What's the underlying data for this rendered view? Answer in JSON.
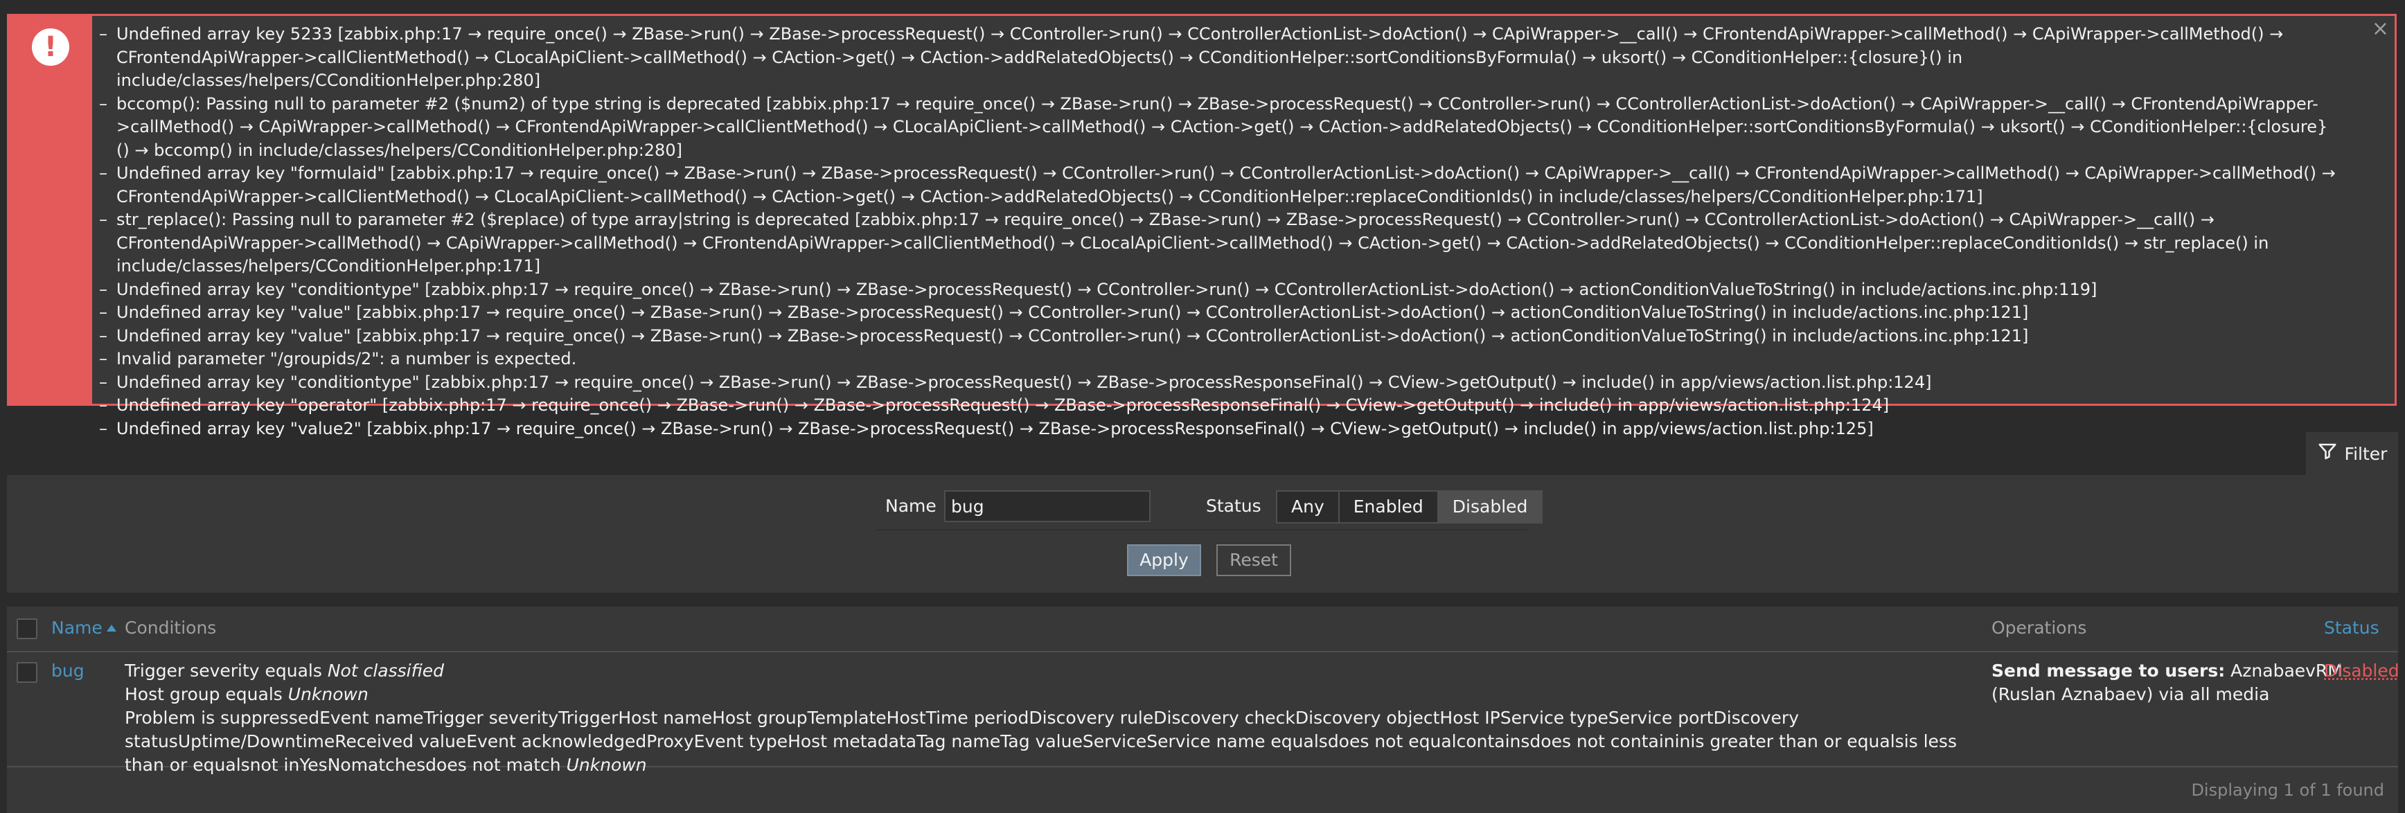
{
  "errors": {
    "close_label": "×",
    "icon_label": "!",
    "messages": [
      "Undefined array key 5233 [zabbix.php:17 → require_once() → ZBase->run() → ZBase->processRequest() → CController->run() → CControllerActionList->doAction() → CApiWrapper->__call() → CFrontendApiWrapper->callMethod() → CApiWrapper->callMethod() → CFrontendApiWrapper->callClientMethod() → CLocalApiClient->callMethod() → CAction->get() → CAction->addRelatedObjects() → CConditionHelper::sortConditionsByFormula() → uksort() → CConditionHelper::{closure}() in include/classes/helpers/CConditionHelper.php:280]",
      "bccomp(): Passing null to parameter #2 ($num2) of type string is deprecated [zabbix.php:17 → require_once() → ZBase->run() → ZBase->processRequest() → CController->run() → CControllerActionList->doAction() → CApiWrapper->__call() → CFrontendApiWrapper->callMethod() → CApiWrapper->callMethod() → CFrontendApiWrapper->callClientMethod() → CLocalApiClient->callMethod() → CAction->get() → CAction->addRelatedObjects() → CConditionHelper::sortConditionsByFormula() → uksort() → CConditionHelper::{closure}() → bccomp() in include/classes/helpers/CConditionHelper.php:280]",
      "Undefined array key \"formulaid\" [zabbix.php:17 → require_once() → ZBase->run() → ZBase->processRequest() → CController->run() → CControllerActionList->doAction() → CApiWrapper->__call() → CFrontendApiWrapper->callMethod() → CApiWrapper->callMethod() → CFrontendApiWrapper->callClientMethod() → CLocalApiClient->callMethod() → CAction->get() → CAction->addRelatedObjects() → CConditionHelper::replaceConditionIds() in include/classes/helpers/CConditionHelper.php:171]",
      "str_replace(): Passing null to parameter #2 ($replace) of type array|string is deprecated [zabbix.php:17 → require_once() → ZBase->run() → ZBase->processRequest() → CController->run() → CControllerActionList->doAction() → CApiWrapper->__call() → CFrontendApiWrapper->callMethod() → CApiWrapper->callMethod() → CFrontendApiWrapper->callClientMethod() → CLocalApiClient->callMethod() → CAction->get() → CAction->addRelatedObjects() → CConditionHelper::replaceConditionIds() → str_replace() in include/classes/helpers/CConditionHelper.php:171]",
      "Undefined array key \"conditiontype\" [zabbix.php:17 → require_once() → ZBase->run() → ZBase->processRequest() → CController->run() → CControllerActionList->doAction() → actionConditionValueToString() in include/actions.inc.php:119]",
      "Undefined array key \"value\" [zabbix.php:17 → require_once() → ZBase->run() → ZBase->processRequest() → CController->run() → CControllerActionList->doAction() → actionConditionValueToString() in include/actions.inc.php:121]",
      "Undefined array key \"value\" [zabbix.php:17 → require_once() → ZBase->run() → ZBase->processRequest() → CController->run() → CControllerActionList->doAction() → actionConditionValueToString() in include/actions.inc.php:121]",
      "Invalid parameter \"/groupids/2\": a number is expected.",
      "Undefined array key \"conditiontype\" [zabbix.php:17 → require_once() → ZBase->run() → ZBase->processRequest() → ZBase->processResponseFinal() → CView->getOutput() → include() in app/views/action.list.php:124]",
      "Undefined array key \"operator\" [zabbix.php:17 → require_once() → ZBase->run() → ZBase->processRequest() → ZBase->processResponseFinal() → CView->getOutput() → include() in app/views/action.list.php:124]",
      "Undefined array key \"value2\" [zabbix.php:17 → require_once() → ZBase->run() → ZBase->processRequest() → ZBase->processResponseFinal() → CView->getOutput() → include() in app/views/action.list.php:125]"
    ]
  },
  "filter": {
    "tab_label": "Filter",
    "name_label": "Name",
    "name_value": "bug",
    "status_label": "Status",
    "status_options": [
      "Any",
      "Enabled",
      "Disabled"
    ],
    "status_selected": "Disabled",
    "apply_label": "Apply",
    "reset_label": "Reset"
  },
  "table": {
    "columns": {
      "name": "Name",
      "conditions": "Conditions",
      "operations": "Operations",
      "status": "Status"
    },
    "rows": [
      {
        "name": "bug",
        "conditions": {
          "line1_prefix": "Trigger severity equals ",
          "line1_value": "Not classified",
          "line2_prefix": "Host group equals ",
          "line2_value": "Unknown",
          "line3_prefix": "Problem is suppressedEvent nameTrigger severityTriggerHost nameHost groupTemplateHostTime periodDiscovery ruleDiscovery checkDiscovery objectHost IPService typeService portDiscovery statusUptime/DowntimeReceived valueEvent acknowledgedProxyEvent typeHost metadataTag nameTag valueServiceService name equalsdoes not equalcontainsdoes not containinis greater than or equalsis less than or equalsnot inYesNomatchesdoes not match ",
          "line3_value": "Unknown"
        },
        "operations": {
          "bold": "Send message to users:",
          "rest": " AznabaevRM (Ruslan Aznabaev) via all media"
        },
        "status": "Disabled"
      }
    ],
    "footer": "Displaying 1 of 1 found"
  },
  "colors": {
    "background": "#2b2b2b",
    "panel": "#383838",
    "error_accent": "#e45959",
    "link": "#4796c4",
    "status_disabled": "#e45959",
    "apply_button": "#687a8a"
  },
  "icons": {
    "error": "exclamation-circle-icon",
    "close": "close-icon",
    "filter": "funnel-icon",
    "sort": "sort-ascending-icon"
  }
}
